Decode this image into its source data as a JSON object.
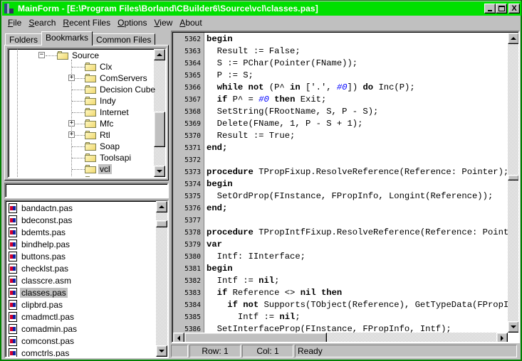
{
  "window": {
    "title": "MainForm - [E:\\Program Files\\Borland\\CBuilder6\\Source\\vcl\\classes.pas]",
    "accent_color": "#00e000",
    "buttons": {
      "minimize": "minimize",
      "maximize": "maximize",
      "close": "X"
    }
  },
  "menu": [
    {
      "label": "File",
      "accel": "F",
      "rest": "ile"
    },
    {
      "label": "Search",
      "accel": "S",
      "rest": "earch"
    },
    {
      "label": "Recent Files",
      "accel": "R",
      "rest": "ecent Files"
    },
    {
      "label": "Options",
      "accel": "O",
      "rest": "ptions"
    },
    {
      "label": "View",
      "accel": "V",
      "rest": "iew"
    },
    {
      "label": "About",
      "accel": "A",
      "rest": "bout"
    }
  ],
  "tabs": [
    {
      "label": "Folders",
      "active": false
    },
    {
      "label": "Bookmarks",
      "active": true
    },
    {
      "label": "Common Files",
      "active": false
    }
  ],
  "tree": {
    "parent": {
      "label": "Source",
      "expanded": true
    },
    "children": [
      {
        "label": "Clx",
        "has_children": false
      },
      {
        "label": "ComServers",
        "has_children": true
      },
      {
        "label": "Decision Cube",
        "has_children": false
      },
      {
        "label": "Indy",
        "has_children": false
      },
      {
        "label": "Internet",
        "has_children": false
      },
      {
        "label": "Mfc",
        "has_children": true
      },
      {
        "label": "Rtl",
        "has_children": true
      },
      {
        "label": "Soap",
        "has_children": false
      },
      {
        "label": "Toolsapi",
        "has_children": false
      },
      {
        "label": "vcl",
        "has_children": false,
        "selected": true,
        "open": true
      }
    ]
  },
  "filter": {
    "value": ""
  },
  "files": [
    {
      "name": "bandactn.pas"
    },
    {
      "name": "bdeconst.pas"
    },
    {
      "name": "bdemts.pas"
    },
    {
      "name": "bindhelp.pas"
    },
    {
      "name": "buttons.pas"
    },
    {
      "name": "checklst.pas"
    },
    {
      "name": "classcre.asm"
    },
    {
      "name": "classes.pas",
      "selected": true
    },
    {
      "name": "clipbrd.pas"
    },
    {
      "name": "cmadmctl.pas"
    },
    {
      "name": "comadmin.pas"
    },
    {
      "name": "comconst.pas"
    },
    {
      "name": "comctrls.pas"
    }
  ],
  "editor": {
    "lines": [
      {
        "no": "5362",
        "tokens": [
          [
            "kw",
            "begin"
          ]
        ]
      },
      {
        "no": "5363",
        "tokens": [
          [
            "t",
            "  Result := False;"
          ]
        ]
      },
      {
        "no": "5364",
        "tokens": [
          [
            "t",
            "  S := PChar(Pointer(FName));"
          ]
        ]
      },
      {
        "no": "5365",
        "tokens": [
          [
            "t",
            "  P := S;"
          ]
        ]
      },
      {
        "no": "5366",
        "tokens": [
          [
            "t",
            "  "
          ],
          [
            "kw",
            "while not"
          ],
          [
            "t",
            " (P^ "
          ],
          [
            "kw",
            "in"
          ],
          [
            "t",
            " ['.', "
          ],
          [
            "num",
            "#0"
          ],
          [
            "t",
            "]) "
          ],
          [
            "kw",
            "do"
          ],
          [
            "t",
            " Inc(P);"
          ]
        ]
      },
      {
        "no": "5367",
        "tokens": [
          [
            "t",
            "  "
          ],
          [
            "kw",
            "if"
          ],
          [
            "t",
            " P^ = "
          ],
          [
            "num",
            "#0"
          ],
          [
            "t",
            " "
          ],
          [
            "kw",
            "then"
          ],
          [
            "t",
            " Exit;"
          ]
        ]
      },
      {
        "no": "5368",
        "tokens": [
          [
            "t",
            "  SetString(FRootName, S, P - S);"
          ]
        ]
      },
      {
        "no": "5369",
        "tokens": [
          [
            "t",
            "  Delete(FName, 1, P - S + 1);"
          ]
        ]
      },
      {
        "no": "5370",
        "tokens": [
          [
            "t",
            "  Result := True;"
          ]
        ]
      },
      {
        "no": "5371",
        "tokens": [
          [
            "kw",
            "end;"
          ]
        ]
      },
      {
        "no": "5372",
        "tokens": []
      },
      {
        "no": "5373",
        "tokens": [
          [
            "kw",
            "procedure"
          ],
          [
            "t",
            " TPropFixup.ResolveReference(Reference: Pointer);"
          ]
        ]
      },
      {
        "no": "5374",
        "tokens": [
          [
            "kw",
            "begin"
          ]
        ]
      },
      {
        "no": "5375",
        "tokens": [
          [
            "t",
            "  SetOrdProp(FInstance, FPropInfo, Longint(Reference));"
          ]
        ]
      },
      {
        "no": "5376",
        "tokens": [
          [
            "kw",
            "end;"
          ]
        ]
      },
      {
        "no": "5377",
        "tokens": []
      },
      {
        "no": "5378",
        "tokens": [
          [
            "kw",
            "procedure"
          ],
          [
            "t",
            " TPropIntfFixup.ResolveReference(Reference: Pointer);"
          ]
        ]
      },
      {
        "no": "5379",
        "tokens": [
          [
            "kw",
            "var"
          ]
        ]
      },
      {
        "no": "5380",
        "tokens": [
          [
            "t",
            "  Intf: IInterface;"
          ]
        ]
      },
      {
        "no": "5381",
        "tokens": [
          [
            "kw",
            "begin"
          ]
        ]
      },
      {
        "no": "5382",
        "tokens": [
          [
            "t",
            "  Intf := "
          ],
          [
            "kw",
            "nil"
          ],
          [
            "t",
            ";"
          ]
        ]
      },
      {
        "no": "5383",
        "tokens": [
          [
            "t",
            "  "
          ],
          [
            "kw",
            "if"
          ],
          [
            "t",
            " Reference <> "
          ],
          [
            "kw",
            "nil then"
          ]
        ]
      },
      {
        "no": "5384",
        "tokens": [
          [
            "t",
            "    "
          ],
          [
            "kw",
            "if not"
          ],
          [
            "t",
            " Supports(TObject(Reference), GetTypeData(FPropInfo"
          ]
        ]
      },
      {
        "no": "5385",
        "tokens": [
          [
            "t",
            "      Intf := "
          ],
          [
            "kw",
            "nil"
          ],
          [
            "t",
            ";"
          ]
        ]
      },
      {
        "no": "5386",
        "tokens": [
          [
            "t",
            "  SetInterfaceProp(FInstance, FPropInfo, Intf);"
          ]
        ]
      }
    ]
  },
  "status": {
    "panel0": "",
    "row": "Row: 1",
    "col": "Col: 1",
    "message": "Ready"
  }
}
